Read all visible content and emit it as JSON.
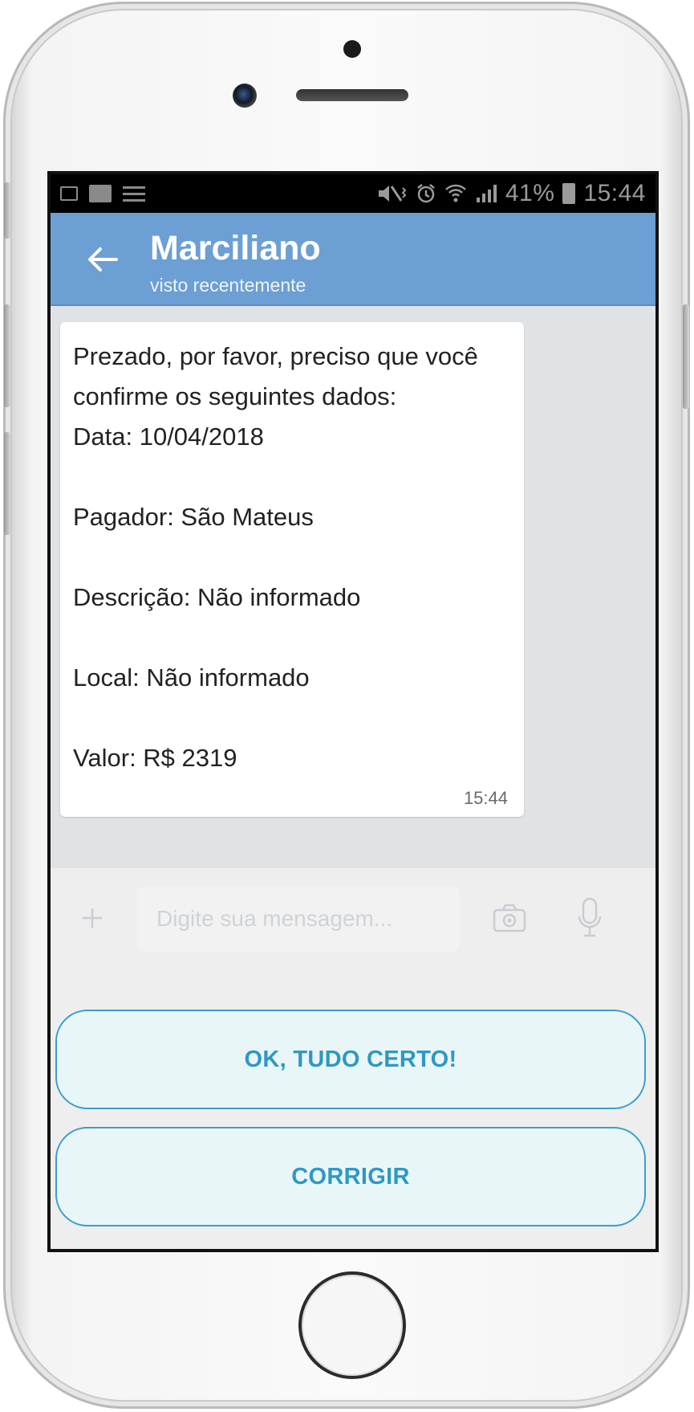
{
  "status_bar": {
    "battery": "41%",
    "time": "15:44"
  },
  "header": {
    "contact_name": "Marciliano",
    "contact_status": "visto recentemente"
  },
  "message": {
    "lines": [
      "Prezado, por favor, preciso que você",
      "confirme os seguintes dados:",
      "Data: 10/04/2018",
      "",
      "Pagador: São Mateus",
      "",
      "Descrição: Não informado",
      "",
      "Local: Não informado",
      "",
      "Valor: R$ 2319"
    ],
    "time": "15:44"
  },
  "composer": {
    "placeholder": "Digite sua mensagem..."
  },
  "actions": {
    "ok_label": "OK, TUDO CERTO!",
    "fix_label": "CORRIGIR"
  },
  "colors": {
    "header_bg": "#6c9fd4",
    "chat_bg": "#dfe3e6",
    "button_accent": "#2e98c4"
  }
}
